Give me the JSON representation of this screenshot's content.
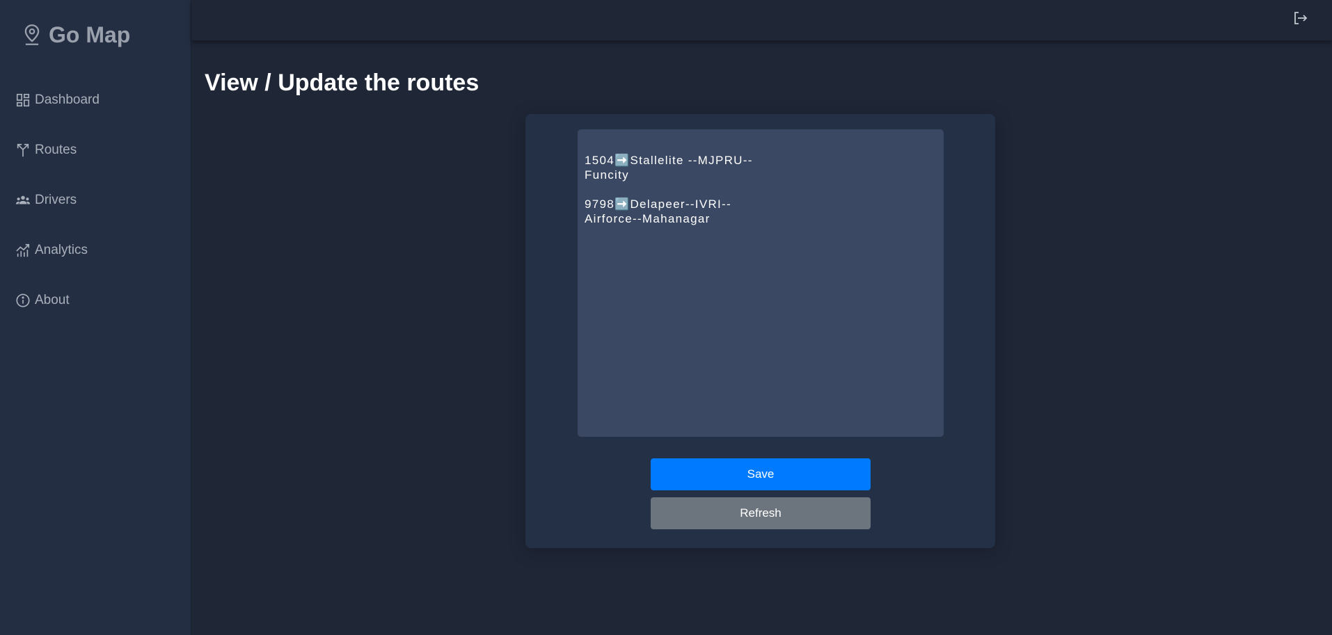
{
  "brand": {
    "title": "Go Map",
    "icon": "location-pin-icon"
  },
  "sidebar": {
    "items": [
      {
        "label": "Dashboard",
        "icon": "dashboard-icon"
      },
      {
        "label": "Routes",
        "icon": "routes-icon"
      },
      {
        "label": "Drivers",
        "icon": "drivers-icon"
      },
      {
        "label": "Analytics",
        "icon": "analytics-icon"
      },
      {
        "label": "About",
        "icon": "info-icon"
      }
    ]
  },
  "topbar": {
    "logout_icon": "logout-icon"
  },
  "main": {
    "title": "View / Update the routes",
    "routes_text": "1504➡️Stallelite --MJPRU--\nFuncity\n\n9798➡️Delapeer--IVRI--\nAirforce--Mahanagar",
    "save_label": "Save",
    "refresh_label": "Refresh"
  },
  "colors": {
    "background": "#1f2636",
    "sidebar": "#232e42",
    "card": "#243046",
    "textarea": "#3a4863",
    "save": "#007bff",
    "refresh": "#6c757d",
    "nav_text": "#a9b0bb"
  }
}
